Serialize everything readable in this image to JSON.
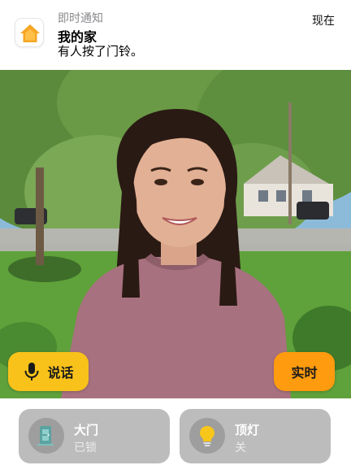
{
  "notification": {
    "category": "即时通知",
    "time": "现在",
    "title": "我的家",
    "body": "有人按了门铃。",
    "app_icon": "home-app-icon"
  },
  "camera": {
    "talk_label": "说话",
    "live_label": "实时",
    "talk_color": "#f8c21a",
    "live_color": "#fe9b0e"
  },
  "accessories": [
    {
      "name": "大门",
      "status": "已锁",
      "icon": "door-lock-icon"
    },
    {
      "name": "顶灯",
      "status": "关",
      "icon": "lightbulb-icon"
    }
  ],
  "colors": {
    "tile_background": "#bcbcbc",
    "home_icon_orange": "#f6a623"
  }
}
